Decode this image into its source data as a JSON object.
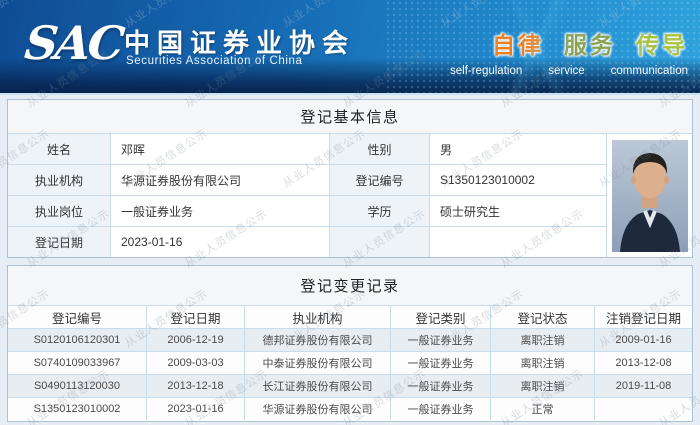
{
  "watermark_text": "从业人员信息公示",
  "header": {
    "logo": "SAC",
    "title_cn": "中国证券业协会",
    "title_en": "Securities Association of China",
    "slogan": [
      {
        "cn": "自律",
        "en": "self-regulation",
        "color": "#ef7e1e"
      },
      {
        "cn": "服务",
        "en": "service",
        "color": "#8ba254"
      },
      {
        "cn": "传导",
        "en": "communication",
        "color": "#a9c23f"
      }
    ],
    "colors": {
      "gradient_left": "#0f4d94",
      "gradient_right": "#2fa3de",
      "bottom_band": "#06224e"
    }
  },
  "basic_info": {
    "title": "登记基本信息",
    "rows": [
      {
        "l1": "姓名",
        "v1": "邓晖",
        "l2": "性别",
        "v2": "男"
      },
      {
        "l1": "执业机构",
        "v1": "华源证券股份有限公司",
        "l2": "登记编号",
        "v2": "S1350123010002"
      },
      {
        "l1": "执业岗位",
        "v1": "一般证券业务",
        "l2": "学历",
        "v2": "硕士研究生"
      },
      {
        "l1": "登记日期",
        "v1": "2023-01-16",
        "l2": "",
        "v2": ""
      }
    ],
    "photo": "portrait-photo-of-registrant"
  },
  "change_records": {
    "title": "登记变更记录",
    "columns": [
      "登记编号",
      "登记日期",
      "执业机构",
      "登记类别",
      "登记状态",
      "注销登记日期"
    ],
    "rows": [
      [
        "S0120106120301",
        "2006-12-19",
        "德邦证券股份有限公司",
        "一般证券业务",
        "离职注销",
        "2009-01-16"
      ],
      [
        "S0740109033967",
        "2009-03-03",
        "中泰证券股份有限公司",
        "一般证券业务",
        "离职注销",
        "2013-12-08"
      ],
      [
        "S0490113120030",
        "2013-12-18",
        "长江证券股份有限公司",
        "一般证券业务",
        "离职注销",
        "2019-11-08"
      ],
      [
        "S1350123010002",
        "2023-01-16",
        "华源证券股份有限公司",
        "一般证券业务",
        "正常",
        ""
      ]
    ]
  }
}
